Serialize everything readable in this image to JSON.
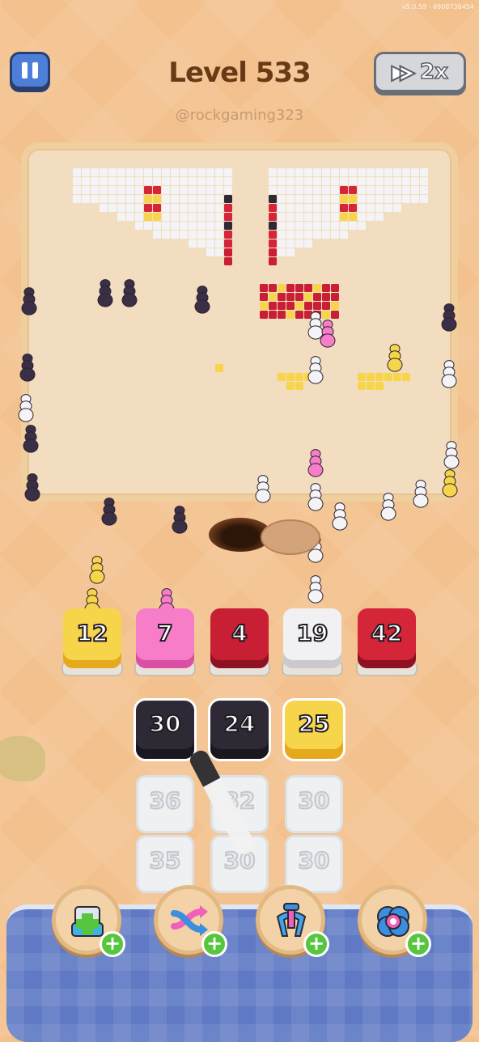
{
  "version": "v5.0.59 - 6908736454",
  "header": {
    "title": "Level 533",
    "handle": "@rockgaming323",
    "speed_label": "2x"
  },
  "colors": {
    "yellow": "#f7d54a",
    "pink": "#f77dc8",
    "red": "#c81f34",
    "white": "#f1f1f3",
    "crimson": "#d42539",
    "dark": "#2f2935",
    "ghost": "#eef0f2",
    "bg": "#f3c18e",
    "tray": "#5f79c4"
  },
  "color_slots": [
    {
      "value": "12",
      "color": "yellow"
    },
    {
      "value": "7",
      "color": "pink"
    },
    {
      "value": "4",
      "color": "red"
    },
    {
      "value": "19",
      "color": "white"
    },
    {
      "value": "42",
      "color": "crimson"
    }
  ],
  "queue": {
    "row1": [
      {
        "value": "30",
        "color": "dark"
      },
      {
        "value": "24",
        "color": "dark"
      },
      {
        "value": "25",
        "color": "yellow"
      }
    ],
    "row2": [
      {
        "value": "36"
      },
      {
        "value": "32"
      },
      {
        "value": "30"
      }
    ],
    "row3": [
      {
        "value": "35"
      },
      {
        "value": "30"
      },
      {
        "value": "30"
      }
    ]
  },
  "boosters": [
    {
      "name": "add-slot-icon"
    },
    {
      "name": "shuffle-icon"
    },
    {
      "name": "magnet-icon"
    },
    {
      "name": "hole-icon"
    }
  ]
}
